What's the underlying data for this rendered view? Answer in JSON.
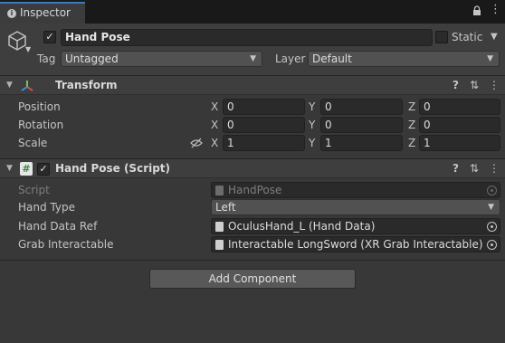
{
  "tab": {
    "title": "Inspector",
    "menu_glyph": "⋮"
  },
  "object": {
    "name": "Hand Pose",
    "active": true,
    "static_label": "Static",
    "static_checked": false,
    "tag_label": "Tag",
    "tag_value": "Untagged",
    "layer_label": "Layer",
    "layer_value": "Default"
  },
  "transform": {
    "title": "Transform",
    "rows": [
      {
        "label": "Position",
        "x": "0",
        "y": "0",
        "z": "0"
      },
      {
        "label": "Rotation",
        "x": "0",
        "y": "0",
        "z": "0"
      },
      {
        "label": "Scale",
        "x": "1",
        "y": "1",
        "z": "1"
      }
    ],
    "axes": {
      "x": "X",
      "y": "Y",
      "z": "Z"
    }
  },
  "script": {
    "title": "Hand Pose (Script)",
    "enabled": true,
    "fields": [
      {
        "label": "Script",
        "value": "HandPose",
        "disabled": true
      },
      {
        "label": "Hand Type",
        "value": "Left"
      },
      {
        "label": "Hand Data Ref",
        "value": "OculusHand_L (Hand Data)"
      },
      {
        "label": "Grab Interactable",
        "value": "Interactable LongSword (XR Grab Interactable)"
      }
    ]
  },
  "header_icons": {
    "help": "?",
    "settings": "⇅",
    "more": "⋮"
  },
  "add_component": "Add Component",
  "colors": {
    "tab_accent": "#3a79bb",
    "background": "#383838",
    "field": "#2a2a2a"
  }
}
